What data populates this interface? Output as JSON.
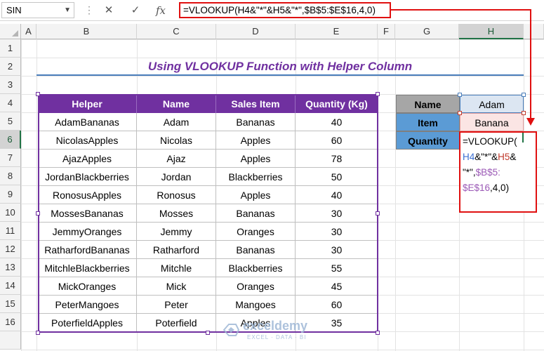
{
  "formula_bar": {
    "name_box": "SIN",
    "cancel_icon": "✕",
    "enter_icon": "✓",
    "fx_label": "fx",
    "formula": "=VLOOKUP(H4&\"*\"&H5&\"*\",$B$5:$E$16,4,0)"
  },
  "columns": [
    "A",
    "B",
    "C",
    "D",
    "E",
    "F",
    "G",
    "H"
  ],
  "selected_column": "H",
  "rows": [
    "1",
    "2",
    "3",
    "4",
    "5",
    "6",
    "7",
    "8",
    "9",
    "10",
    "11",
    "12",
    "13",
    "14",
    "15",
    "16"
  ],
  "selected_row": "6",
  "title": "Using VLOOKUP Function with Helper Column",
  "table": {
    "headers": [
      "Helper",
      "Name",
      "Sales Item",
      "Quantity (Kg)"
    ],
    "rows": [
      [
        "AdamBananas",
        "Adam",
        "Bananas",
        "40"
      ],
      [
        "NicolasApples",
        "Nicolas",
        "Apples",
        "60"
      ],
      [
        "AjazApples",
        "Ajaz",
        "Apples",
        "78"
      ],
      [
        "JordanBlackberries",
        "Jordan",
        "Blackberries",
        "50"
      ],
      [
        "RonosusApples",
        "Ronosus",
        "Apples",
        "40"
      ],
      [
        "MossesBananas",
        "Mosses",
        "Bananas",
        "30"
      ],
      [
        "JemmyOranges",
        "Jemmy",
        "Oranges",
        "30"
      ],
      [
        "RatharfordBananas",
        "Ratharford",
        "Bananas",
        "30"
      ],
      [
        "MitchleBlackberries",
        "Mitchle",
        "Blackberries",
        "55"
      ],
      [
        "MickOranges",
        "Mick",
        "Oranges",
        "45"
      ],
      [
        "PeterMangoes",
        "Peter",
        "Mangoes",
        "60"
      ],
      [
        "PoterfieldApples",
        "Poterfield",
        "Apples",
        "35"
      ]
    ]
  },
  "lookup": {
    "name_label": "Name",
    "name_value": "Adam",
    "item_label": "Item",
    "item_value": "Banana",
    "quantity_label": "Quantity",
    "formula_parts": {
      "p1": "=VLOOKUP(",
      "p2": "H4",
      "p3": "&\"*\"&",
      "p4": "H5",
      "p5": "&",
      "p6": "\"*\",",
      "p7": "$B$5:",
      "p8": "$E$16",
      "p9": ",4,0)"
    }
  },
  "watermark": {
    "brand": "exceldemy",
    "tagline": "EXCEL · DATA · BI"
  },
  "colors": {
    "accent": "#7030a0",
    "name_fill": "#a6a6a6",
    "item_fill": "#5b9bd5",
    "highlight": "#e01010"
  }
}
